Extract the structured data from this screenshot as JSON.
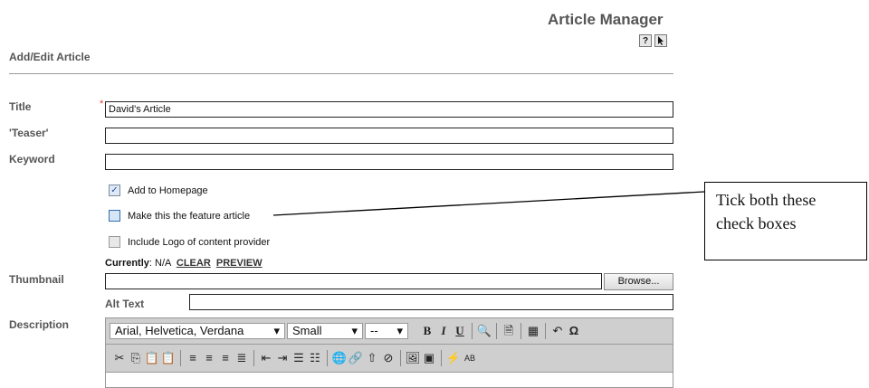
{
  "header": {
    "title": "Article Manager",
    "help_label": "?",
    "pointer_label": "pointer"
  },
  "section": {
    "label": "Add/Edit Article"
  },
  "fields": {
    "title": {
      "label": "Title",
      "value": "David's Article",
      "required_mark": "*"
    },
    "teaser": {
      "label": "'Teaser'",
      "value": ""
    },
    "keyword": {
      "label": "Keyword",
      "value": ""
    }
  },
  "checkboxes": [
    {
      "label": "Add to Homepage",
      "checked": true
    },
    {
      "label": "Make this the feature article",
      "checked": false
    },
    {
      "label": "Include Logo of content provider",
      "checked": false
    }
  ],
  "thumbnail": {
    "label": "Thumbnail",
    "currently_label": "Currently",
    "currently_value": ": N/A",
    "clear_label": "CLEAR",
    "preview_label": "PREVIEW",
    "browse_label": "Browse...",
    "alt_text_label": "Alt Text",
    "alt_text_value": ""
  },
  "description": {
    "label": "Description",
    "font_select": "Arial, Helvetica, Verdana",
    "size_select": "Small",
    "format_select": "--"
  },
  "callout": {
    "line1": "Tick both these",
    "line2": "check boxes"
  }
}
